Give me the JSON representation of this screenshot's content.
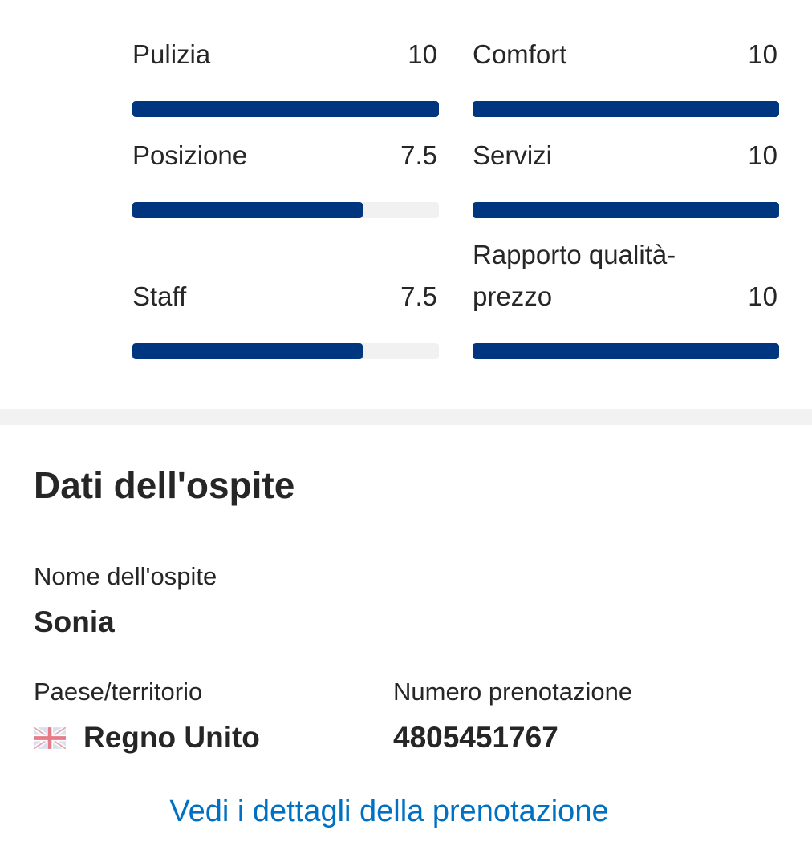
{
  "scores": [
    {
      "label": "Pulizia",
      "value": "10",
      "fraction": 1.0
    },
    {
      "label": "Comfort",
      "value": "10",
      "fraction": 1.0
    },
    {
      "label": "Posizione",
      "value": "7.5",
      "fraction": 0.75
    },
    {
      "label": "Servizi",
      "value": "10",
      "fraction": 1.0
    },
    {
      "label": "Staff",
      "value": "7.5",
      "fraction": 0.75
    },
    {
      "label": "Rapporto qualità-prezzo",
      "value": "10",
      "fraction": 1.0
    }
  ],
  "guest": {
    "title": "Dati dell'ospite",
    "name_label": "Nome dell'ospite",
    "name": "Sonia",
    "country_label": "Paese/territorio",
    "country": "Regno Unito",
    "country_flag_icon": "uk-flag-icon",
    "booking_label": "Numero prenotazione",
    "booking_number": "4805451767",
    "details_link": "Vedi i dettagli della prenotazione"
  },
  "colors": {
    "bar_fill": "#003580",
    "bar_track": "#f1f1f1",
    "link": "#0071c2",
    "text": "#262626"
  }
}
